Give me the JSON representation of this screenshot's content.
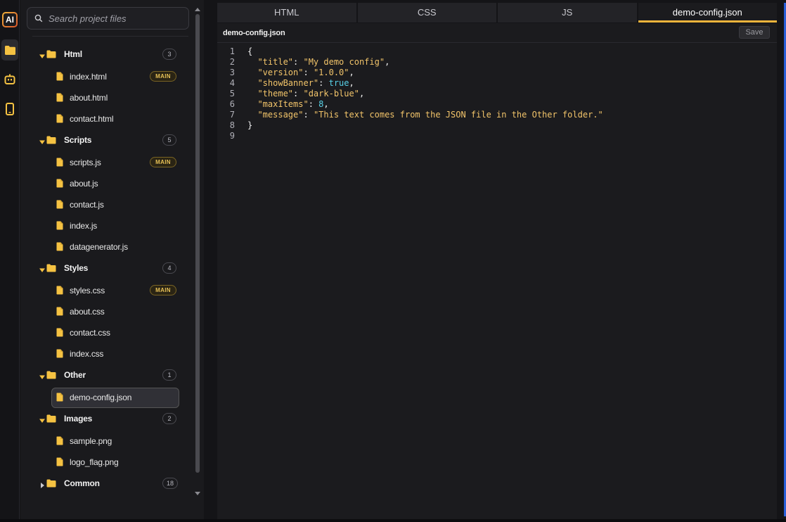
{
  "rail": {
    "logo_text": "AI",
    "items": [
      "folder-icon",
      "robot-icon",
      "phone-icon"
    ],
    "active": 0
  },
  "search": {
    "placeholder": "Search project files"
  },
  "tree": {
    "folders": [
      {
        "name": "Html",
        "count": "3",
        "open": true,
        "files": [
          {
            "name": "index.html",
            "badge": "MAIN"
          },
          {
            "name": "about.html"
          },
          {
            "name": "contact.html"
          }
        ]
      },
      {
        "name": "Scripts",
        "count": "5",
        "open": true,
        "files": [
          {
            "name": "scripts.js",
            "badge": "MAIN"
          },
          {
            "name": "about.js"
          },
          {
            "name": "contact.js"
          },
          {
            "name": "index.js"
          },
          {
            "name": "datagenerator.js"
          }
        ]
      },
      {
        "name": "Styles",
        "count": "4",
        "open": true,
        "files": [
          {
            "name": "styles.css",
            "badge": "MAIN"
          },
          {
            "name": "about.css"
          },
          {
            "name": "contact.css"
          },
          {
            "name": "index.css"
          }
        ]
      },
      {
        "name": "Other",
        "count": "1",
        "open": true,
        "files": [
          {
            "name": "demo-config.json",
            "selected": true
          }
        ]
      },
      {
        "name": "Images",
        "count": "2",
        "open": true,
        "files": [
          {
            "name": "sample.png"
          },
          {
            "name": "logo_flag.png"
          }
        ]
      },
      {
        "name": "Common",
        "count": "18",
        "open": false,
        "files": []
      }
    ]
  },
  "tabs": [
    {
      "label": "HTML"
    },
    {
      "label": "CSS"
    },
    {
      "label": "JS"
    },
    {
      "label": "demo-config.json",
      "active": true
    }
  ],
  "editor": {
    "title": "demo-config.json",
    "save_label": "Save",
    "lines": [
      {
        "n": "1",
        "parts": [
          [
            "p",
            "{"
          ]
        ]
      },
      {
        "n": "2",
        "parts": [
          [
            "p",
            "  "
          ],
          [
            "k",
            "\"title\""
          ],
          [
            "p",
            ": "
          ],
          [
            "s",
            "\"My demo config\""
          ],
          [
            "p",
            ","
          ]
        ]
      },
      {
        "n": "3",
        "parts": [
          [
            "p",
            "  "
          ],
          [
            "k",
            "\"version\""
          ],
          [
            "p",
            ": "
          ],
          [
            "s",
            "\"1.0.0\""
          ],
          [
            "p",
            ","
          ]
        ]
      },
      {
        "n": "4",
        "parts": [
          [
            "p",
            "  "
          ],
          [
            "k",
            "\"showBanner\""
          ],
          [
            "p",
            ": "
          ],
          [
            "b",
            "true"
          ],
          [
            "p",
            ","
          ]
        ]
      },
      {
        "n": "5",
        "parts": [
          [
            "p",
            "  "
          ],
          [
            "k",
            "\"theme\""
          ],
          [
            "p",
            ": "
          ],
          [
            "s",
            "\"dark-blue\""
          ],
          [
            "p",
            ","
          ]
        ]
      },
      {
        "n": "6",
        "parts": [
          [
            "p",
            "  "
          ],
          [
            "k",
            "\"maxItems\""
          ],
          [
            "p",
            ": "
          ],
          [
            "n",
            "8"
          ],
          [
            "p",
            ","
          ]
        ]
      },
      {
        "n": "7",
        "parts": [
          [
            "p",
            "  "
          ],
          [
            "k",
            "\"message\""
          ],
          [
            "p",
            ": "
          ],
          [
            "s",
            "\"This text comes from the JSON file in the Other folder.\""
          ]
        ]
      },
      {
        "n": "8",
        "parts": [
          [
            "p",
            "}"
          ]
        ]
      },
      {
        "n": "9",
        "parts": []
      }
    ]
  },
  "colors": {
    "accent": "#f0b43c",
    "folder": "#f5c242",
    "string": "#f2c46a",
    "literal": "#58d2e8"
  }
}
